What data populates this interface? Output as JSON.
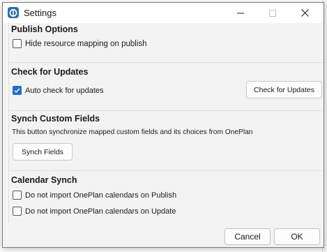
{
  "window": {
    "title": "Settings",
    "controls": {
      "minimize_icon": "minimize-icon",
      "maximize_icon": "maximize-icon",
      "close_icon": "close-icon"
    },
    "app_icon": "oneplan-logo-icon"
  },
  "sections": {
    "publish": {
      "title": "Publish Options",
      "hide_mapping": {
        "label": "Hide resource mapping on publish",
        "checked": false
      }
    },
    "updates": {
      "title": "Check for Updates",
      "auto_check": {
        "label": "Auto check for updates",
        "checked": true
      },
      "check_button": "Check for Updates"
    },
    "synch_fields": {
      "title": "Synch Custom Fields",
      "description": "This button synchronize mapped custom fields and its choices from OnePlan",
      "button": "Synch Fields"
    },
    "calendar": {
      "title": "Calendar Synch",
      "no_import_publish": {
        "label": "Do not import OnePlan calendars on Publish",
        "checked": false
      },
      "no_import_update": {
        "label": "Do not import OnePlan calendars on Update",
        "checked": false
      }
    }
  },
  "footer": {
    "cancel": "Cancel",
    "ok": "OK"
  },
  "colors": {
    "accent": "#1f6fc5",
    "window_bg": "#f3f3f3"
  }
}
